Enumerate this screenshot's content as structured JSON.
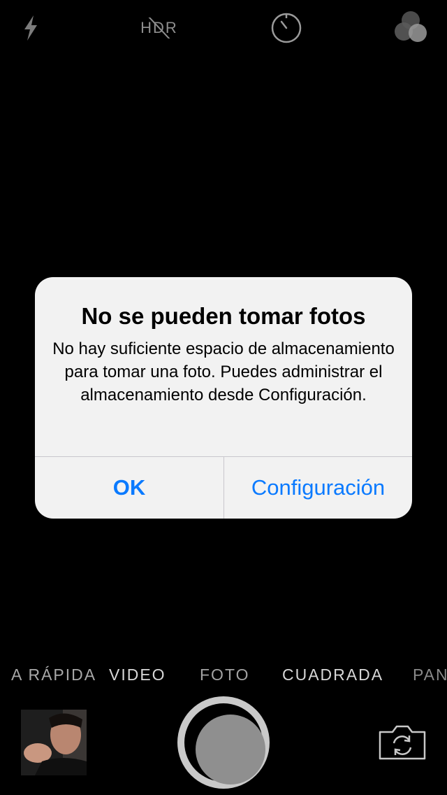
{
  "top_controls": {
    "flash_icon": "lightning-bolt",
    "hdr_label": "HDR",
    "timer_icon": "timer",
    "filters_icon": "overlapping-circles"
  },
  "alert": {
    "title": "No se pueden tomar fotos",
    "message": "No hay suficiente espacio de almacenamiento para tomar una foto. Puedes administrar el almacenamiento desde Configuración.",
    "ok_label": "OK",
    "settings_label": "Configuración",
    "button_color": "#0a7aff",
    "background_color": "#f2f2f2"
  },
  "modes": {
    "rapida": "A RÁPIDA",
    "video": "VIDEO",
    "foto": "FOTO",
    "cuadrada": "CUADRADA",
    "pano": "PAN"
  },
  "bottom_controls": {
    "thumbnail_icon": "last-photo-thumbnail",
    "shutter_icon": "shutter",
    "switch_camera_icon": "camera-switch"
  }
}
